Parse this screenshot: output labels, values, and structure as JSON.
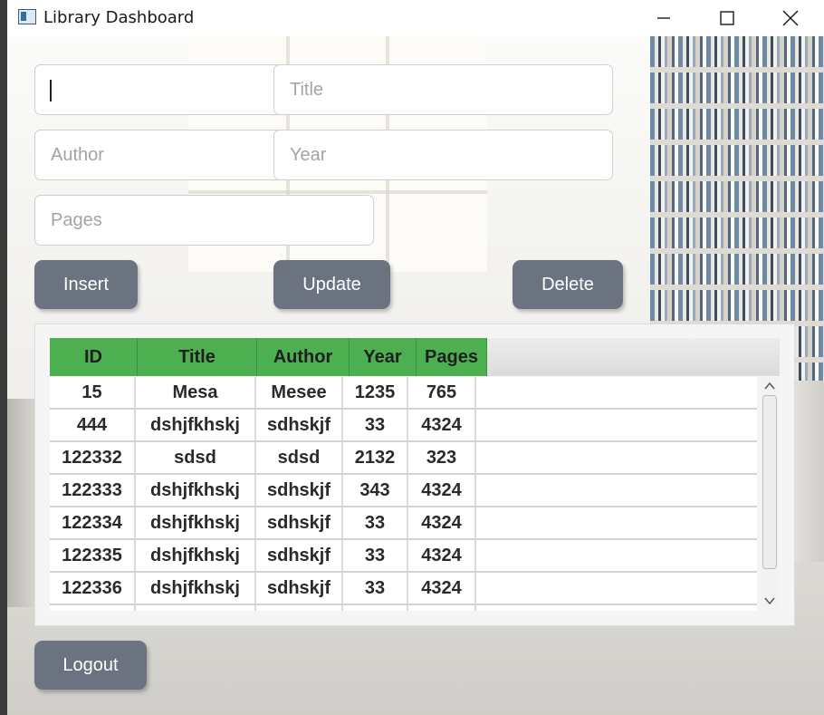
{
  "window": {
    "title": "Library Dashboard"
  },
  "form": {
    "id_value": "",
    "title_placeholder": "Title",
    "author_placeholder": "Author",
    "year_placeholder": "Year",
    "pages_placeholder": "Pages"
  },
  "buttons": {
    "insert": "Insert",
    "update": "Update",
    "delete": "Delete",
    "logout": "Logout"
  },
  "table": {
    "columns": [
      "ID",
      "Title",
      "Author",
      "Year",
      "Pages"
    ],
    "rows": [
      [
        "15",
        "Mesa",
        "Mesee",
        "1235",
        "765"
      ],
      [
        "444",
        "dshjfkhskj",
        "sdhskjf",
        "33",
        "4324"
      ],
      [
        "122332",
        "sdsd",
        "sdsd",
        "2132",
        "323"
      ],
      [
        "122333",
        "dshjfkhskj",
        "sdhskjf",
        "343",
        "4324"
      ],
      [
        "122334",
        "dshjfkhskj",
        "sdhskjf",
        "33",
        "4324"
      ],
      [
        "122335",
        "dshjfkhskj",
        "sdhskjf",
        "33",
        "4324"
      ],
      [
        "122336",
        "dshjfkhskj",
        "sdhskjf",
        "33",
        "4324"
      ]
    ]
  },
  "colors": {
    "header_green": "#4caf50",
    "button_gray": "#6c7380"
  }
}
